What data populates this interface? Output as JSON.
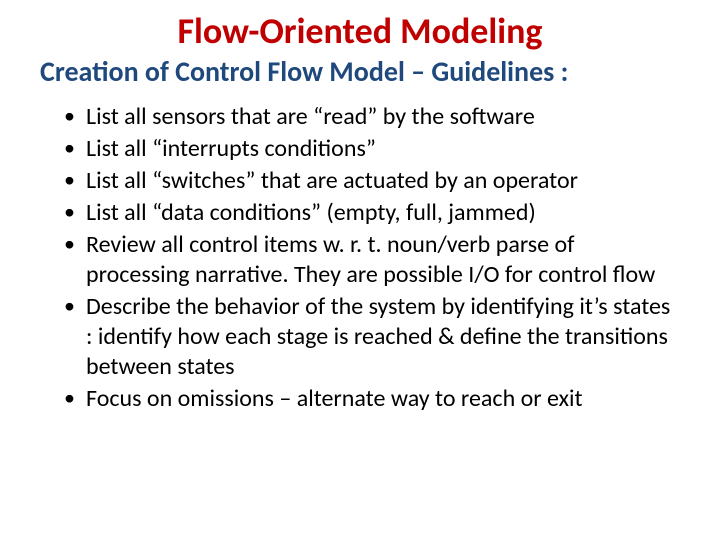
{
  "title": "Flow-Oriented Modeling",
  "subtitle": "Creation of Control Flow Model – Guidelines :",
  "bullets": [
    "List all sensors that are “read” by the software",
    "List all “interrupts conditions”",
    "List all “switches” that are actuated by an operator",
    "List all “data conditions” (empty, full, jammed)",
    "Review all control items w. r. t. noun/verb parse of processing narrative. They are possible I/O for control flow",
    "Describe the behavior of the system by identifying it’s  states : identify how each stage is reached & define the transitions between states",
    "Focus on omissions – alternate way to reach or exit"
  ]
}
